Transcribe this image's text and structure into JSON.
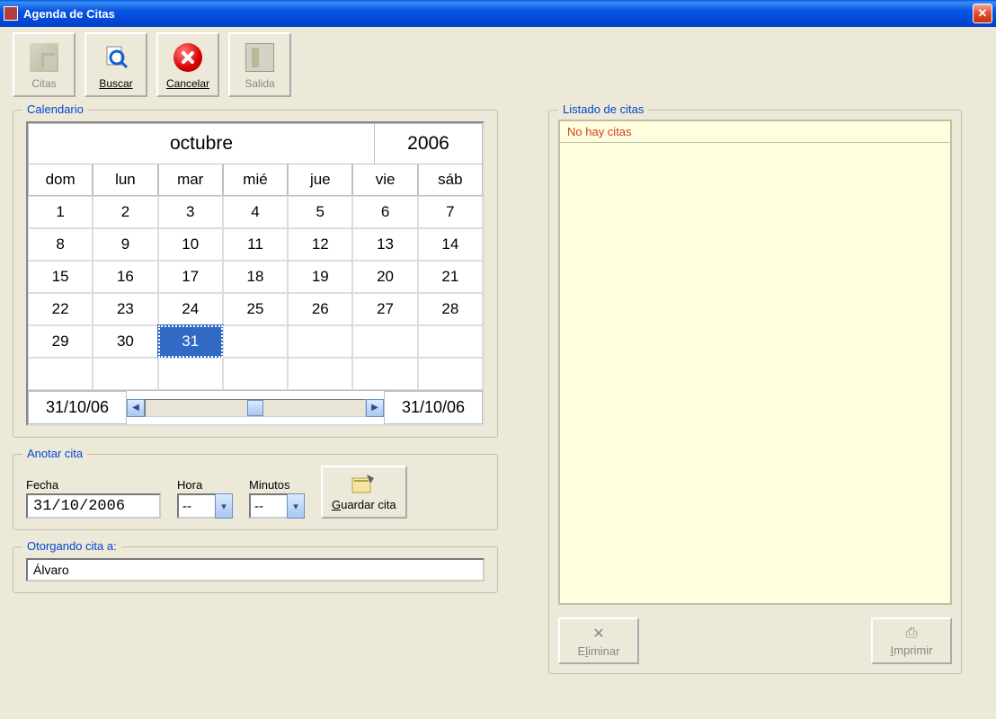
{
  "window": {
    "title": "Agenda de Citas"
  },
  "toolbar": {
    "citas": "Citas",
    "buscar": "Buscar",
    "cancelar": "Cancelar",
    "salida": "Salida"
  },
  "calendar": {
    "legend": "Calendario",
    "month": "octubre",
    "year": "2006",
    "day_headers": [
      "dom",
      "lun",
      "mar",
      "mié",
      "jue",
      "vie",
      "sáb"
    ],
    "weeks": [
      [
        "1",
        "2",
        "3",
        "4",
        "5",
        "6",
        "7"
      ],
      [
        "8",
        "9",
        "10",
        "11",
        "12",
        "13",
        "14"
      ],
      [
        "15",
        "16",
        "17",
        "18",
        "19",
        "20",
        "21"
      ],
      [
        "22",
        "23",
        "24",
        "25",
        "26",
        "27",
        "28"
      ],
      [
        "29",
        "30",
        "31",
        "",
        "",
        "",
        ""
      ],
      [
        "",
        "",
        "",
        "",
        "",
        "",
        ""
      ]
    ],
    "selected_day": "31",
    "date_left": "31/10/06",
    "date_right": "31/10/06"
  },
  "anotar": {
    "legend": "Anotar cita",
    "fecha_label": "Fecha",
    "fecha_value": "31/10/2006",
    "hora_label": "Hora",
    "hora_value": "--",
    "minutos_label": "Minutos",
    "minutos_value": "--",
    "guardar_label": "Guardar cita"
  },
  "otorgando": {
    "legend": "Otorgando cita a:",
    "value": "Álvaro"
  },
  "listado": {
    "legend": "Listado de citas",
    "empty_text": "No hay citas"
  },
  "actions": {
    "eliminar": "Eliminar",
    "imprimir": "Imprimir"
  }
}
